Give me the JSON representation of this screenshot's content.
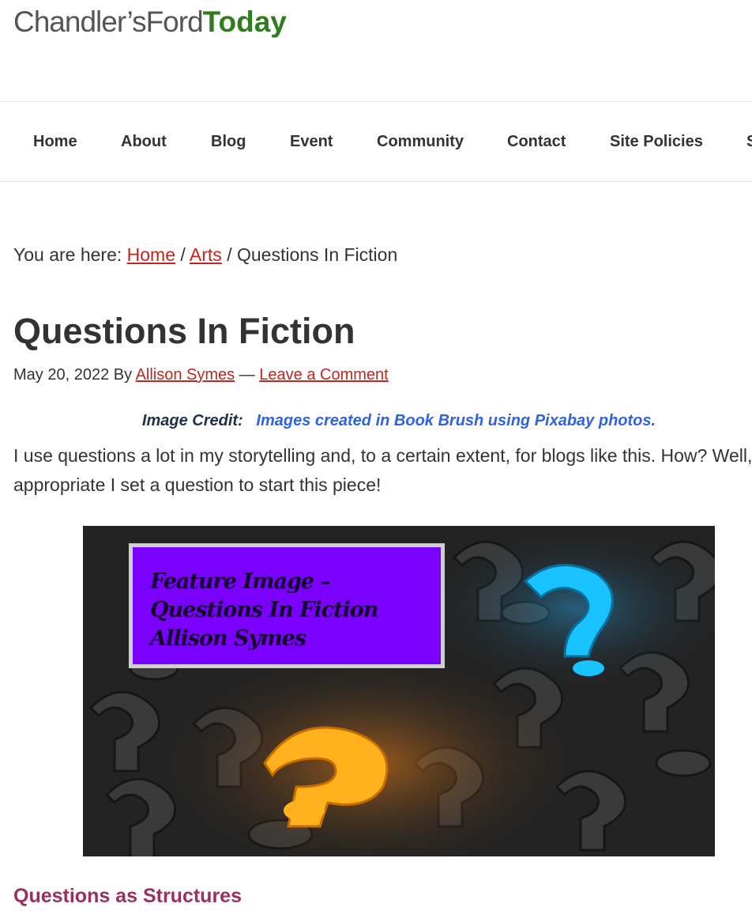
{
  "logo": {
    "part_a": "Chandler’sFord",
    "part_b": "Today",
    "color_a": "#555555",
    "color_b": "#2f7d1e"
  },
  "nav": {
    "items": [
      {
        "label": "Home"
      },
      {
        "label": "About"
      },
      {
        "label": "Blog"
      },
      {
        "label": "Event"
      },
      {
        "label": "Community"
      },
      {
        "label": "Contact"
      },
      {
        "label": "Site Policies"
      },
      {
        "label": "S"
      }
    ]
  },
  "breadcrumb": {
    "prefix": "You are here:",
    "home": "Home",
    "sep1": "/",
    "arts": "Arts",
    "sep2": "/",
    "current": "Questions In Fiction"
  },
  "post": {
    "title": "Questions In Fiction",
    "date": "May 20, 2022",
    "by": "By",
    "author": "Allison Symes",
    "dash": "—",
    "comment_link": "Leave a Comment",
    "credit_label": "Image Credit:",
    "credit_value": "Images created in Book Brush using Pixabay photos.",
    "intro_line1": "I use questions a lot in my storytelling and, to a certain extent, for blogs like this. How? Well, it",
    "intro_line2": "appropriate I set a question to start this piece!",
    "feature_caption": [
      "Feature Image –",
      "Questions In Fiction",
      "Allison Symes"
    ],
    "section_heading": "Questions as Structures"
  },
  "colors": {
    "link": "#c3251d",
    "heading_accent": "#9b2f5e",
    "credit_blue": "#2f63e0",
    "caption_bg": "#7a00ff"
  }
}
